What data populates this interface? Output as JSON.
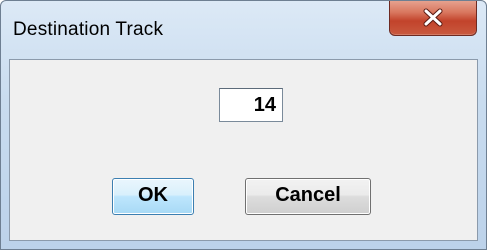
{
  "window": {
    "title": "Destination Track",
    "close_icon": "close-x-icon"
  },
  "form": {
    "track_value": "14"
  },
  "buttons": {
    "ok_label": "OK",
    "cancel_label": "Cancel"
  },
  "colors": {
    "titlebar": "#c9dcef",
    "close_button": "#c2432b",
    "client": "#f0f0f0",
    "ok_button_accent": "#3c7fb1"
  }
}
